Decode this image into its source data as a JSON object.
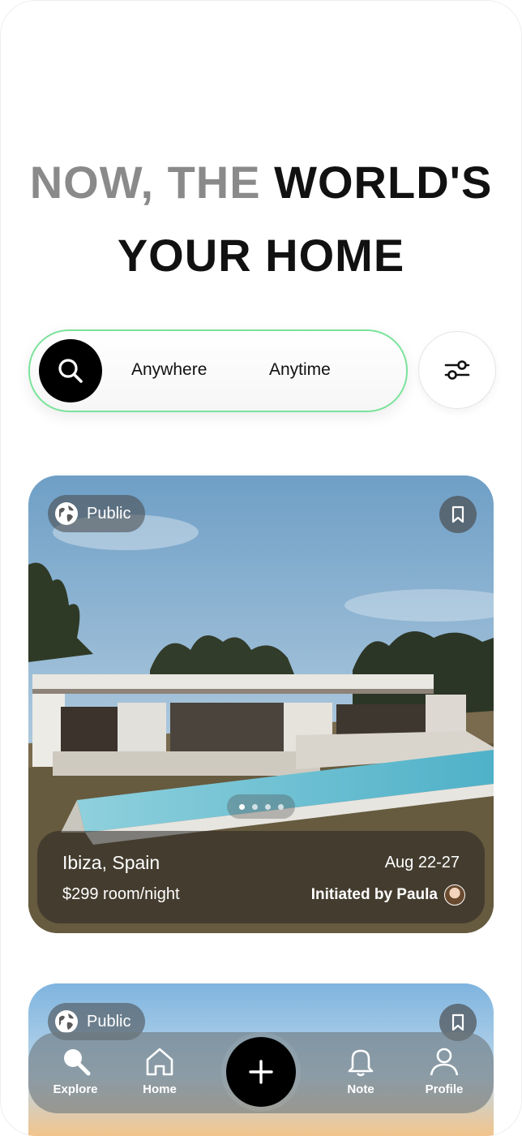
{
  "headline": {
    "muted": "NOW, THE",
    "strong_line1": "WORLD'S",
    "line2": "YOUR HOME"
  },
  "search": {
    "where": "Anywhere",
    "when": "Anytime"
  },
  "listings": [
    {
      "badge": "Public",
      "location": "Ibiza, Spain",
      "dates": "Aug 22-27",
      "price": "$299 room/night",
      "initiated_by": "Initiated by Paula",
      "photo_count": 4,
      "active_photo": 1
    },
    {
      "badge": "Public"
    }
  ],
  "nav": {
    "explore": "Explore",
    "home": "Home",
    "note": "Note",
    "profile": "Profile"
  },
  "colors": {
    "accent_border": "#7be39b",
    "primary": "#000000",
    "muted_text": "#8a8a8a"
  },
  "icons": [
    "search-icon",
    "filter-sliders-icon",
    "globe-icon",
    "bookmark-icon",
    "plus-icon",
    "home-icon",
    "bell-icon",
    "user-icon"
  ]
}
